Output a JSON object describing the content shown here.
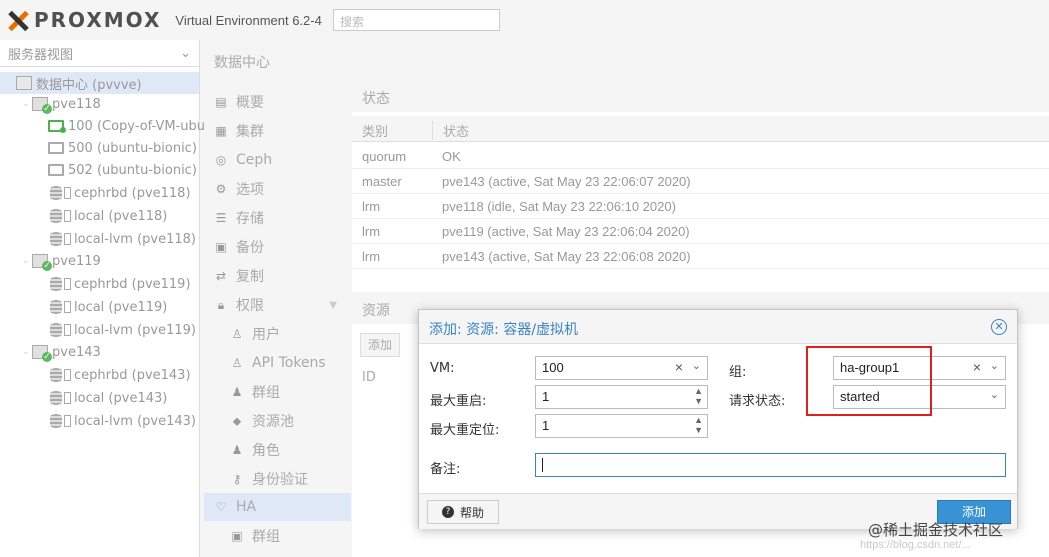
{
  "header": {
    "logo_text": "PROXMOX",
    "version": "Virtual Environment 6.2-4",
    "search_placeholder": "搜索"
  },
  "tree": {
    "view_label": "服务器视图",
    "items": [
      {
        "label": "数据中心 (pvvve)",
        "icon": "datacenter-icon"
      },
      {
        "label": "pve118",
        "icon": "node-icon"
      },
      {
        "label": "100 (Copy-of-VM-ubu",
        "icon": "vm-running-icon"
      },
      {
        "label": "500 (ubuntu-bionic)",
        "icon": "vm-icon"
      },
      {
        "label": "502 (ubuntu-bionic)",
        "icon": "vm-icon"
      },
      {
        "label": "cephrbd (pve118)",
        "icon": "storage-icon"
      },
      {
        "label": "local (pve118)",
        "icon": "storage-icon"
      },
      {
        "label": "local-lvm (pve118)",
        "icon": "storage-icon"
      },
      {
        "label": "pve119",
        "icon": "node-icon"
      },
      {
        "label": "cephrbd (pve119)",
        "icon": "storage-icon"
      },
      {
        "label": "local (pve119)",
        "icon": "storage-icon"
      },
      {
        "label": "local-lvm (pve119)",
        "icon": "storage-icon"
      },
      {
        "label": "pve143",
        "icon": "node-icon"
      },
      {
        "label": "cephrbd (pve143)",
        "icon": "storage-icon"
      },
      {
        "label": "local (pve143)",
        "icon": "storage-icon"
      },
      {
        "label": "local-lvm (pve143)",
        "icon": "storage-icon"
      }
    ]
  },
  "content_title": "数据中心",
  "nav": {
    "items": [
      {
        "label": "概要",
        "icon": "summary-icon"
      },
      {
        "label": "集群",
        "icon": "cluster-icon"
      },
      {
        "label": "Ceph",
        "icon": "ceph-icon"
      },
      {
        "label": "选项",
        "icon": "options-icon"
      },
      {
        "label": "存储",
        "icon": "storage-icon"
      },
      {
        "label": "备份",
        "icon": "backup-icon"
      },
      {
        "label": "复制",
        "icon": "replication-icon"
      },
      {
        "label": "权限",
        "icon": "permissions-icon"
      },
      {
        "label": "用户",
        "icon": "user-icon"
      },
      {
        "label": "API Tokens",
        "icon": "token-icon"
      },
      {
        "label": "群组",
        "icon": "group-icon"
      },
      {
        "label": "资源池",
        "icon": "pool-icon"
      },
      {
        "label": "角色",
        "icon": "role-icon"
      },
      {
        "label": "身份验证",
        "icon": "auth-icon"
      },
      {
        "label": "HA",
        "icon": "ha-icon"
      },
      {
        "label": "群组",
        "icon": "group-icon"
      }
    ]
  },
  "status_panel": {
    "title": "状态",
    "columns": [
      "类别",
      "状态"
    ],
    "rows": [
      {
        "type": "quorum",
        "status": "OK"
      },
      {
        "type": "master",
        "status": "pve143 (active, Sat May 23 22:06:07 2020)"
      },
      {
        "type": "lrm",
        "status": "pve118 (idle, Sat May 23 22:06:10 2020)"
      },
      {
        "type": "lrm",
        "status": "pve119 (active, Sat May 23 22:06:04 2020)"
      },
      {
        "type": "lrm",
        "status": "pve143 (active, Sat May 23 22:06:08 2020)"
      }
    ]
  },
  "resources_panel": {
    "title": "资源",
    "add_label": "添加",
    "id_column": "ID"
  },
  "dialog": {
    "title": "添加: 资源: 容器/虚拟机",
    "vm_label": "VM:",
    "vm_value": "100",
    "max_restart_label": "最大重启:",
    "max_restart_value": "1",
    "max_relocate_label": "最大重定位:",
    "max_relocate_value": "1",
    "group_label": "组:",
    "group_value": "ha-group1",
    "request_state_label": "请求状态:",
    "request_state_value": "started",
    "comment_label": "备注:",
    "comment_value": "",
    "help_label": "帮助",
    "add_label": "添加"
  },
  "watermark": {
    "line1": "@稀土掘金技术社区",
    "line2": "https://blog.csdn.net/..."
  },
  "colors": {
    "accent": "#3a82c4",
    "add_button": "#3892d4",
    "highlight_box": "#e21f1f",
    "logo_orange": "#e57000"
  }
}
